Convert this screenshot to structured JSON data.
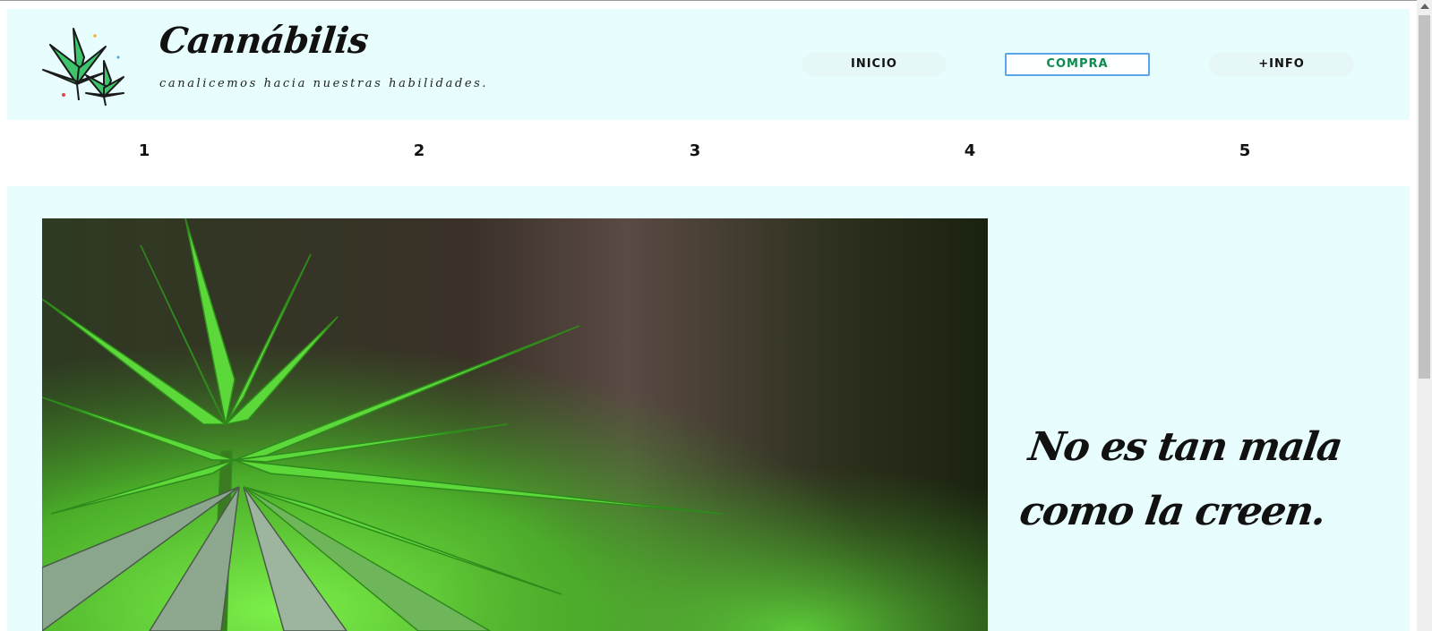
{
  "header": {
    "brand": "Cannábilis",
    "tagline": "canalicemos hacia nuestras habilidades."
  },
  "nav": [
    {
      "label": "INICIO"
    },
    {
      "label": "COMPRA"
    },
    {
      "label": "+INFO"
    }
  ],
  "numbers": [
    "1",
    "2",
    "3",
    "4",
    "5"
  ],
  "main": {
    "quote_line1": "No es tan mala",
    "quote_line2": "como la creen."
  },
  "colors": {
    "panel_bg": "#e8fdfd",
    "active_border": "#5aa6e8",
    "active_text": "#0e8a4e",
    "leaf_green": "#3ec46d"
  },
  "icons": [
    "cannabis-leaf-logo",
    "scroll-up-arrow"
  ]
}
